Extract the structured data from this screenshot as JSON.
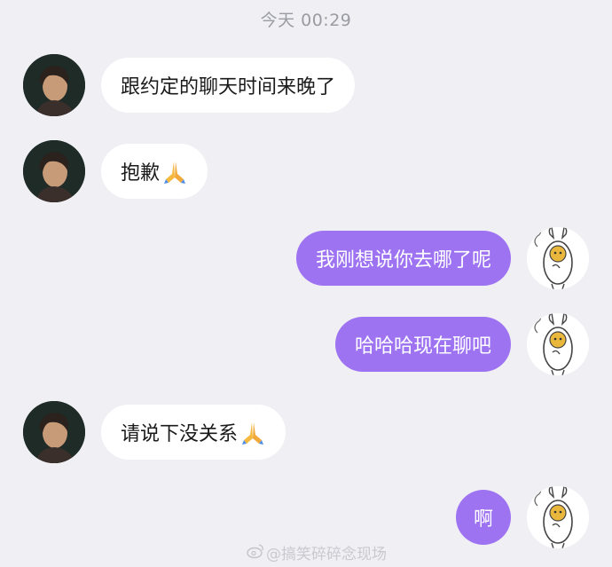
{
  "header": {
    "timestamp": "今天 00:29"
  },
  "messages": [
    {
      "text": "跟约定的聊天时间来晚了",
      "emoji": ""
    },
    {
      "text": "抱歉",
      "emoji": "pray-emoji"
    },
    {
      "text": "我刚想说你去哪了呢",
      "emoji": ""
    },
    {
      "text": "哈哈哈现在聊吧",
      "emoji": ""
    },
    {
      "text": "请说下没关系",
      "emoji": "pray-emoji"
    },
    {
      "text": "啊",
      "emoji": ""
    }
  ],
  "colors": {
    "background": "#efeff4",
    "incoming_bubble": "#ffffff",
    "outgoing_bubble": "#9e73f2",
    "timestamp": "#9b9ba3"
  },
  "watermark": {
    "text": "@搞笑碎碎念现场"
  }
}
